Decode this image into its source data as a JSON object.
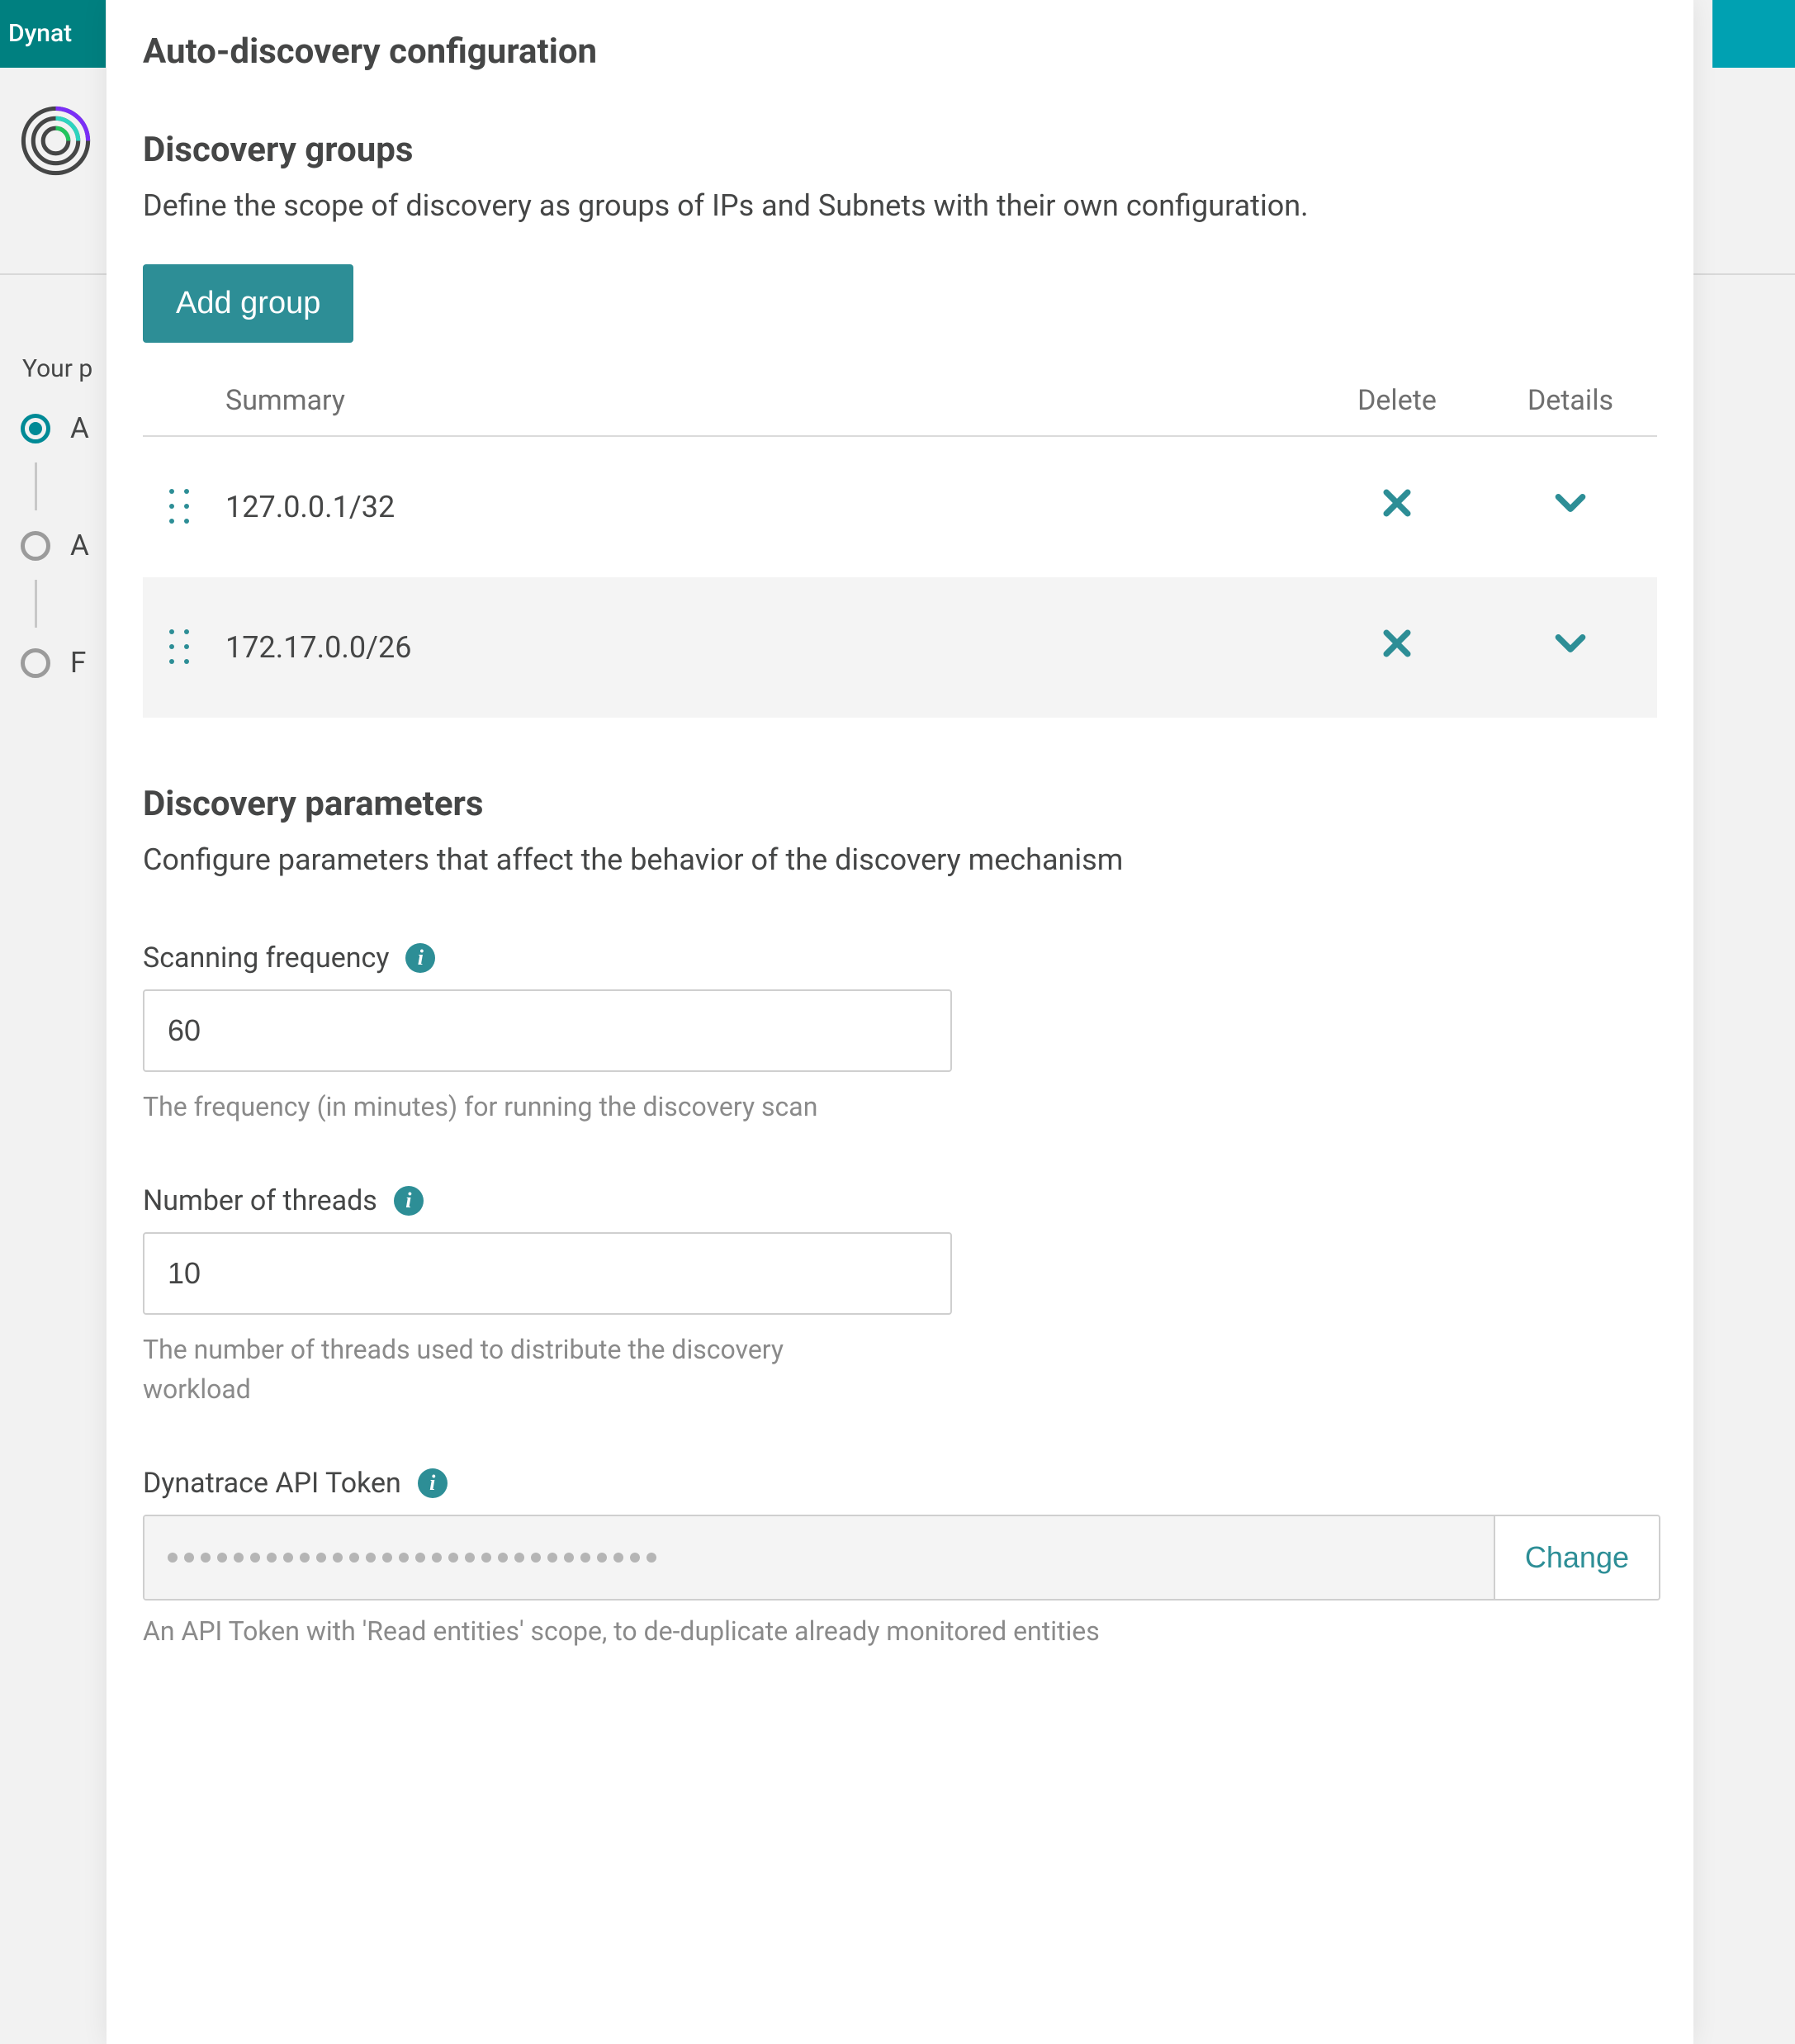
{
  "topbar": {
    "brand_fragment": "Dynat"
  },
  "side_peek": {
    "label": "Your p",
    "items": [
      {
        "letter": "A",
        "selected": true
      },
      {
        "letter": "A",
        "selected": false
      },
      {
        "letter": "F",
        "selected": false
      }
    ]
  },
  "panel": {
    "title": "Auto-discovery configuration",
    "groups": {
      "heading": "Discovery groups",
      "description": "Define the scope of discovery as groups of IPs and Subnets with their own configuration.",
      "add_button": "Add group",
      "columns": {
        "summary": "Summary",
        "delete": "Delete",
        "details": "Details"
      },
      "rows": [
        {
          "summary": "127.0.0.1/32"
        },
        {
          "summary": "172.17.0.0/26"
        }
      ]
    },
    "params": {
      "heading": "Discovery parameters",
      "description": "Configure parameters that affect the behavior of the discovery mechanism",
      "scanning_frequency": {
        "label": "Scanning frequency",
        "value": "60",
        "help": "The frequency (in minutes) for running the discovery scan"
      },
      "threads": {
        "label": "Number of threads",
        "value": "10",
        "help": "The number of threads used to distribute the discovery workload"
      },
      "token": {
        "label": "Dynatrace API Token",
        "masked_dot_count": 30,
        "change_label": "Change",
        "help": "An API Token with 'Read entities' scope, to de-duplicate already monitored entities"
      }
    }
  }
}
